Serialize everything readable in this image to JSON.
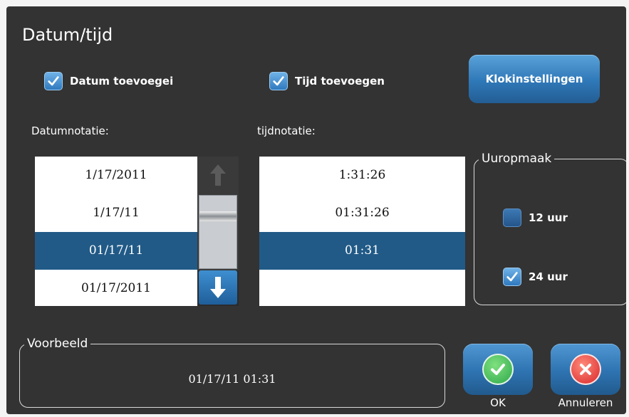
{
  "window": {
    "title": "Datum/tijd"
  },
  "options": {
    "add_date_label": "Datum toevoegei",
    "add_date_checked": true,
    "add_time_label": "Tijd toevoegen",
    "add_time_checked": true,
    "clock_settings_label": "Klokinstellingen"
  },
  "date_format": {
    "label": "Datumnotatie:",
    "items": [
      "1/17/2011",
      "1/17/11",
      "01/17/11",
      "01/17/2011"
    ],
    "selected": "01/17/11"
  },
  "time_format": {
    "label": "tijdnotatie:",
    "items": [
      "1:31:26",
      "01:31:26",
      "01:31"
    ],
    "selected": "01:31"
  },
  "hour_format": {
    "legend": "Uuropmaak",
    "option_12": "12 uur",
    "option_12_checked": false,
    "option_24": "24 uur",
    "option_24_checked": true
  },
  "preview": {
    "legend": "Voorbeeld",
    "value": "01/17/11 01:31"
  },
  "actions": {
    "ok_label": "OK",
    "cancel_label": "Annuleren"
  },
  "icons": [
    "checkmark-icon",
    "arrow-up-icon",
    "arrow-down-icon",
    "ok-check-icon",
    "cancel-x-icon"
  ],
  "colors": {
    "background": "#333333",
    "selection": "#215a87",
    "accent_blue": "#2f78b8",
    "ok_green": "#39b54a",
    "cancel_red": "#e0322f"
  }
}
